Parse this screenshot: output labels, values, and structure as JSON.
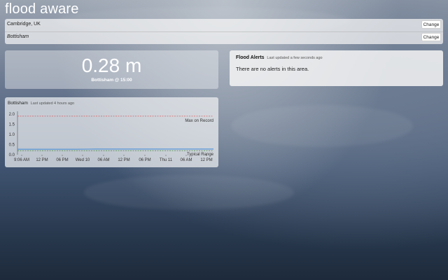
{
  "app": {
    "title": "flood aware"
  },
  "locations": [
    {
      "text": "Cambridge, UK",
      "button": "Change"
    },
    {
      "text": "Bottisham",
      "button": "Change"
    }
  ],
  "level": {
    "value": "0.28 m",
    "caption": "Bottisham @ 15:00"
  },
  "alerts": {
    "title": "Flood Alerts",
    "updated": "Last updated a few seconds ago",
    "message": "There are no alerts in this area."
  },
  "chart": {
    "station": "Bottisham",
    "updated": "Last updated 4 hours ago"
  },
  "chart_data": {
    "type": "line",
    "title": "",
    "xlabel": "",
    "ylabel": "",
    "ylim": [
      0,
      2.0
    ],
    "yticks": [
      "2.0",
      "1.5",
      "1.0",
      "0.5",
      "0.0"
    ],
    "x_tick_labels": [
      "9:06 AM",
      "12 PM",
      "06 PM",
      "Wed 10",
      "06 AM",
      "12 PM",
      "06 PM",
      "Thu 11",
      "06 AM",
      "12 PM"
    ],
    "series": [
      {
        "values": [
          0.27,
          0.27,
          0.27,
          0.27,
          0.28,
          0.28,
          0.28,
          0.28,
          0.28,
          0.28,
          0.28
        ],
        "color": "#4a8fd8"
      }
    ],
    "reference_lines": [
      {
        "label": "Max on Record",
        "value": 1.9,
        "style": "dashed",
        "color": "#d84a4a"
      },
      {
        "label": "Typical Range",
        "value": 0.2,
        "style": "dashed",
        "color": "#2a7a2a"
      }
    ],
    "grid": false
  },
  "colors": {
    "series": "#4a8fd8",
    "max_line": "#d84a4a",
    "typical_line": "#2a7a2a"
  }
}
